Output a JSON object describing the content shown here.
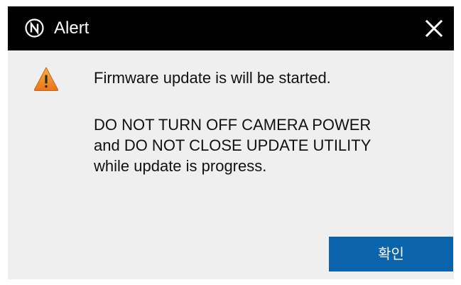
{
  "window": {
    "title": "Alert",
    "logo_icon": "n-circle-logo-icon",
    "close_icon": "close-icon",
    "titlebar_color": "#000000"
  },
  "message": {
    "icon": "warning-icon",
    "line1": "Firmware update is will be started.",
    "line2": "DO NOT TURN OFF CAMERA POWER",
    "line3": "and DO NOT CLOSE UPDATE UTILITY",
    "line4": "while update is progress."
  },
  "buttons": {
    "confirm_label": "확인",
    "confirm_color": "#0b63ac"
  }
}
